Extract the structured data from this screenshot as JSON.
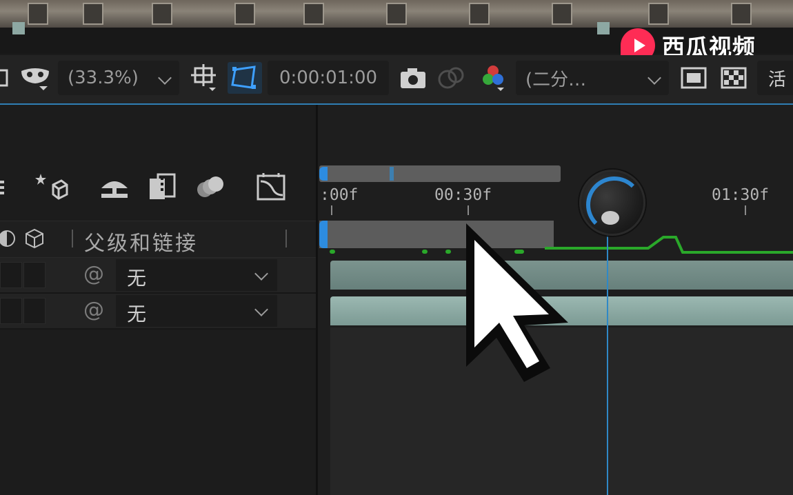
{
  "watermark": {
    "text": "西瓜视频"
  },
  "toolbar": {
    "zoom": "(33.3%)",
    "timecode": "0:00:01:00",
    "resolution": "(二分…",
    "right_label": "活"
  },
  "timeline": {
    "ruler_labels": [
      ":00f",
      "00:30f",
      "01:30f"
    ],
    "column_header": "父级和链接"
  },
  "layers": [
    {
      "parent": "无"
    },
    {
      "parent": "无"
    }
  ],
  "colors": {
    "accent_blue": "#2d8ce0",
    "keyframe_green": "#2aa82a",
    "clip_teal": "#86a19b"
  }
}
